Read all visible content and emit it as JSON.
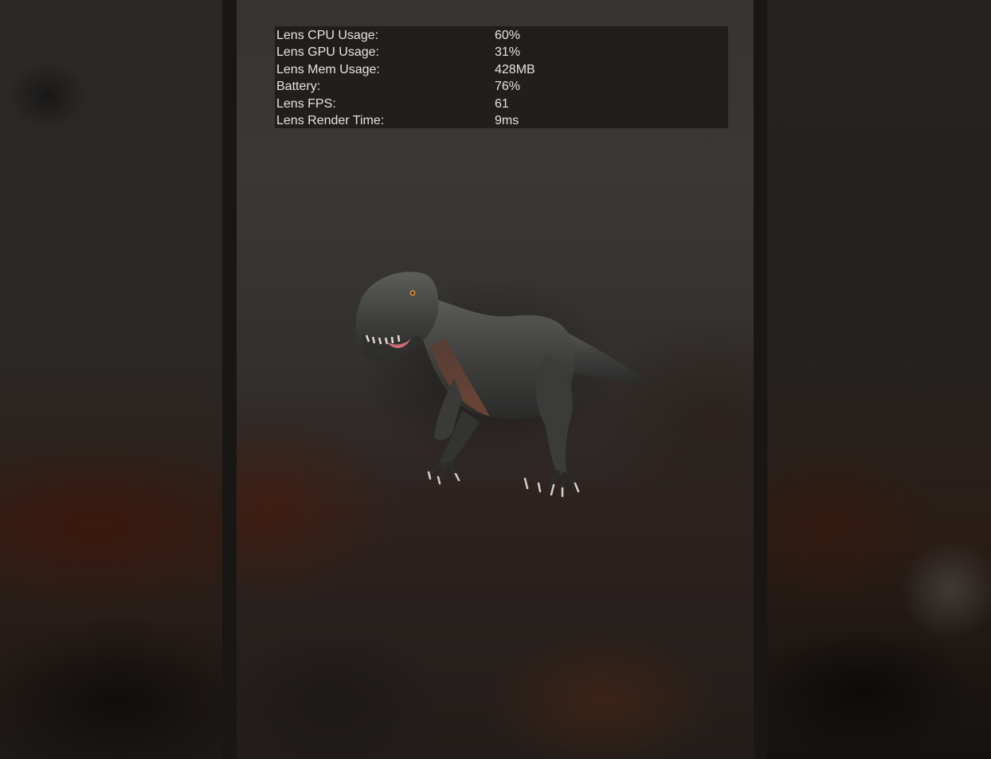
{
  "stats": [
    {
      "label": "Lens CPU Usage:",
      "value": "60%"
    },
    {
      "label": "Lens GPU Usage:",
      "value": "31%"
    },
    {
      "label": "Lens Mem Usage:",
      "value": "428MB"
    },
    {
      "label": "Battery:",
      "value": "76%"
    },
    {
      "label": "Lens FPS:",
      "value": "61"
    },
    {
      "label": "Lens Render Time:",
      "value": "9ms"
    }
  ],
  "ar_object": {
    "icon": "t-rex-model"
  }
}
